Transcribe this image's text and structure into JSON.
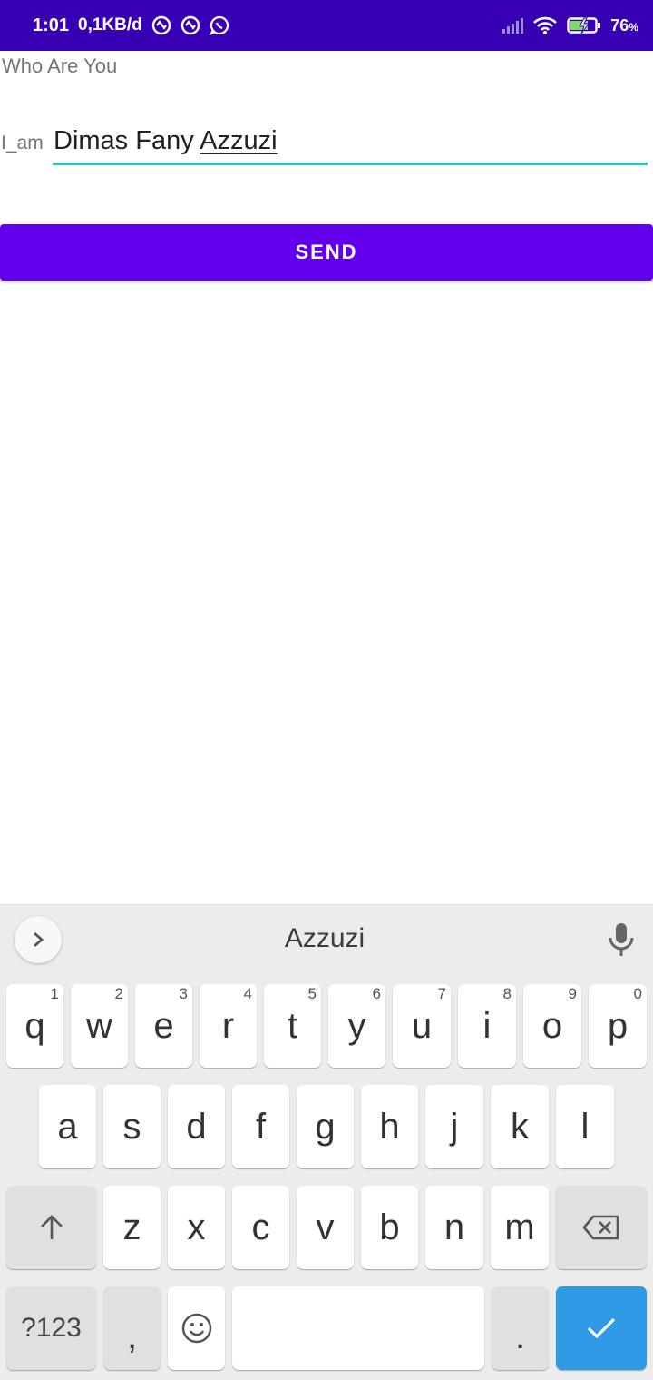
{
  "status_bar": {
    "time": "1:01",
    "network_speed": "0,1KB/d",
    "battery": "76",
    "battery_unit": "%",
    "icons": [
      "notification-icon",
      "notification-icon",
      "whatsapp-icon",
      "signal-icon",
      "wifi-icon",
      "battery-charging-icon"
    ]
  },
  "app": {
    "title": "Who Are You",
    "iam_label": "I_am",
    "name_value_plain": "Dimas Fany ",
    "name_value_composing": "Azzuzi",
    "send_label": "SEND",
    "accent": "#6200ee",
    "status_bar_color": "#3700b3",
    "input_underline_color": "#26c6b5"
  },
  "keyboard": {
    "suggestion": "Azzuzi",
    "row1": [
      {
        "label": "q",
        "hint": "1"
      },
      {
        "label": "w",
        "hint": "2"
      },
      {
        "label": "e",
        "hint": "3"
      },
      {
        "label": "r",
        "hint": "4"
      },
      {
        "label": "t",
        "hint": "5"
      },
      {
        "label": "y",
        "hint": "6"
      },
      {
        "label": "u",
        "hint": "7"
      },
      {
        "label": "i",
        "hint": "8"
      },
      {
        "label": "o",
        "hint": "9"
      },
      {
        "label": "p",
        "hint": "0"
      }
    ],
    "row2": [
      "a",
      "s",
      "d",
      "f",
      "g",
      "h",
      "j",
      "k",
      "l"
    ],
    "row3": [
      "z",
      "x",
      "c",
      "v",
      "b",
      "n",
      "m"
    ],
    "symbols_label": "?123",
    "comma_label": ",",
    "period_label": ".",
    "enter_color": "#2f9be6"
  }
}
